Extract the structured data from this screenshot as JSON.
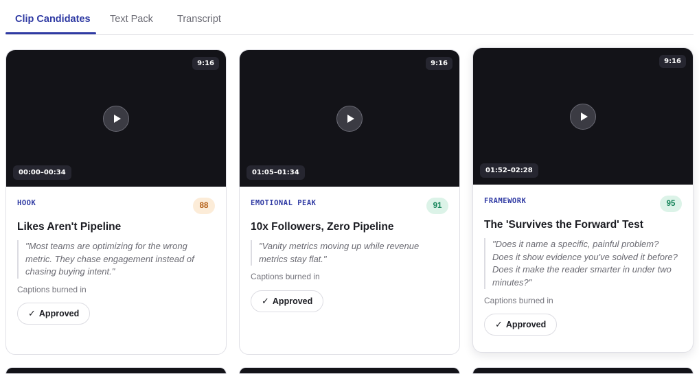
{
  "tabs": [
    {
      "label": "Clip Candidates"
    },
    {
      "label": "Text Pack"
    },
    {
      "label": "Transcript"
    }
  ],
  "cards": [
    {
      "ratio": "9:16",
      "time_range": "00:00–00:34",
      "tag": "HOOK",
      "score": "88",
      "title": "Likes Aren't Pipeline",
      "quote": "\"Most teams are optimizing for the wrong metric. They chase engagement instead of chasing buying intent.\"",
      "captions": "Captions burned in",
      "status": "Approved"
    },
    {
      "ratio": "9:16",
      "time_range": "01:05–01:34",
      "tag": "EMOTIONAL PEAK",
      "score": "91",
      "title": "10x Followers, Zero Pipeline",
      "quote": "\"Vanity metrics moving up while revenue metrics stay flat.\"",
      "captions": "Captions burned in",
      "status": "Approved"
    },
    {
      "ratio": "9:16",
      "time_range": "01:52–02:28",
      "tag": "FRAMEWORK",
      "score": "95",
      "title": "The 'Survives the Forward' Test",
      "quote": "\"Does it name a specific, painful problem? Does it show evidence you've solved it before? Does it make the reader smarter in under two minutes?\"",
      "captions": "Captions burned in",
      "status": "Approved"
    }
  ],
  "icons": {
    "play": "play-icon",
    "check": "check-icon"
  },
  "colors": {
    "accent": "#2f3aa3",
    "video_bg": "#131318",
    "score_warm_bg": "#fcecd8",
    "score_warm_text": "#b35c12",
    "score_green_bg": "#dcf3e8",
    "score_green_text": "#16855a"
  }
}
